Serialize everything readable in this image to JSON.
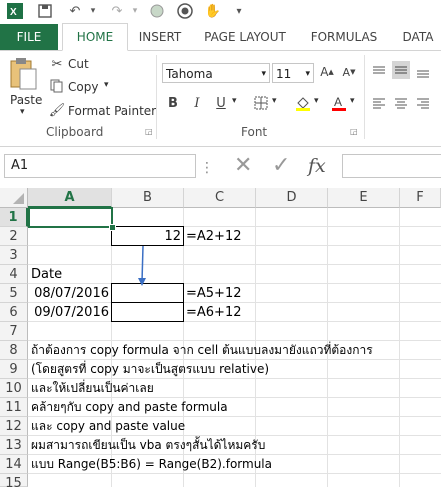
{
  "quick_access": {
    "app_icon": "excel-icon",
    "save_icon": "save-icon",
    "undo_icon": "undo-icon",
    "redo_icon": "redo-icon"
  },
  "tabs": [
    {
      "label": "FILE"
    },
    {
      "label": "HOME"
    },
    {
      "label": "INSERT"
    },
    {
      "label": "PAGE LAYOUT"
    },
    {
      "label": "FORMULAS"
    },
    {
      "label": "DATA"
    }
  ],
  "clipboard": {
    "paste_label": "Paste",
    "cut_label": "Cut",
    "copy_label": "Copy",
    "format_painter_label": "Format Painter",
    "group_label": "Clipboard"
  },
  "font": {
    "font_name": "Tahoma",
    "font_size": "11",
    "bold": "B",
    "italic": "I",
    "underline": "U",
    "group_label": "Font"
  },
  "formula_bar": {
    "name_box": "A1",
    "fx": "fx"
  },
  "grid": {
    "columns": [
      "A",
      "B",
      "C",
      "D",
      "E",
      "F"
    ],
    "rows": [
      "1",
      "2",
      "3",
      "4",
      "5",
      "6",
      "7",
      "8",
      "9",
      "10",
      "11",
      "12",
      "13",
      "14",
      "15"
    ],
    "cells": {
      "B2": "12",
      "C2": "=A2+12",
      "A4": "Date",
      "A5": "08/07/2016",
      "C5": "=A5+12",
      "A6": "09/07/2016",
      "C6": "=A6+12",
      "A8": "ถ้าต้องการ copy formula จาก cell ต้นแบบลงมายังแถวที่ต้องการ",
      "A9": "(โดยสูตรที่ copy มาจะเป็นสูตรแบบ relative)",
      "A10": "และให้เปลี่ยนเป็นค่าเลย",
      "A11": "คล้ายๆกับ copy and paste formula",
      "A12": "และ copy and paste value",
      "A13": "ผมสามารถเขียนเป็น vba ตรงๆสั้นได้ไหมครับ",
      "A14": "แบบ Range(B5:B6) = Range(B2).formula"
    }
  },
  "colors": {
    "accent": "#217346",
    "arrow": "#3b6fc4"
  }
}
